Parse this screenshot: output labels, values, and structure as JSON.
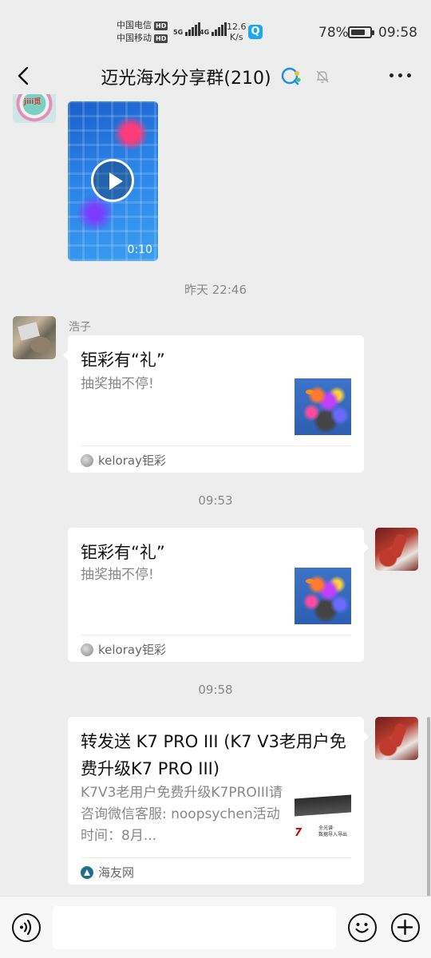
{
  "status_bar": {
    "carrier1": "中国电信",
    "carrier2": "中国移动",
    "hd": "HD",
    "sig1": "5G",
    "sig2": "4G",
    "speed_value": "12.6",
    "speed_unit": "K/s",
    "battery_pct": "78%",
    "battery_level": 0.78,
    "time": "09:58"
  },
  "nav": {
    "title": "迈光海水分享群(210)",
    "back_icon": "chevron-left-icon",
    "more_icon": "more-horizontal-icon"
  },
  "chat": {
    "video": {
      "duration": "0:10"
    },
    "timestamps": [
      "昨天 22:46",
      "09:53",
      "09:58"
    ],
    "messages": [
      {
        "sender": "浩子",
        "card": {
          "title": "钜彩有“礼”",
          "desc": "抽奖抽不停!",
          "source": "keloray钜彩"
        }
      },
      {
        "sender": "",
        "card": {
          "title": "钜彩有“礼”",
          "desc": "抽奖抽不停!",
          "source": "keloray钜彩"
        }
      },
      {
        "sender": "",
        "card": {
          "title": "转发送 K7 PRO III (K7 V3老用户免费升级K7 PRO III)",
          "desc": "K7V3老用户免费升级K7PROIII请咨询微信客服: noopsychen活动时间：8月...",
          "source": "海友网",
          "thumb_brand": "7",
          "thumb_caption": "全光谱·\n数据导入导出"
        }
      }
    ]
  },
  "input_bar": {
    "voice_icon": "voice-icon",
    "emoji_icon": "emoji-icon",
    "plus_icon": "plus-icon",
    "placeholder": ""
  }
}
